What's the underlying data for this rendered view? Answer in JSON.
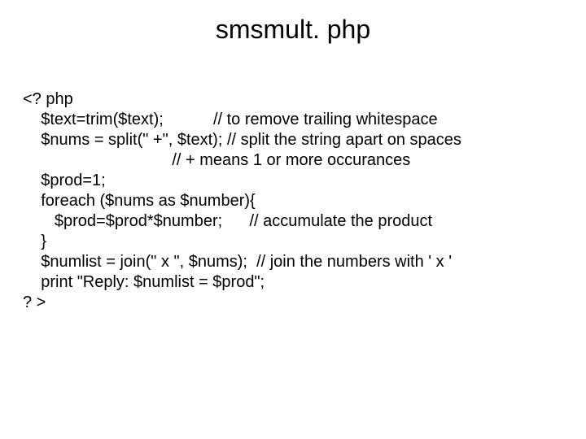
{
  "title": "smsmult. php",
  "code": {
    "l1": "<? php",
    "l2": "    $text=trim($text);           // to remove trailing whitespace",
    "l3": "    $nums = split(\" +\", $text); // split the string apart on spaces",
    "l4": "                                 // + means 1 or more occurances",
    "l5": "    $prod=1;",
    "l6": "    foreach ($nums as $number){",
    "l7": "       $prod=$prod*$number;      // accumulate the product",
    "l8": "    }",
    "l9": "    $numlist = join(\" x \", $nums);  // join the numbers with ' x '",
    "l10": "    print \"Reply: $numlist = $prod\";",
    "l11": "? >"
  }
}
